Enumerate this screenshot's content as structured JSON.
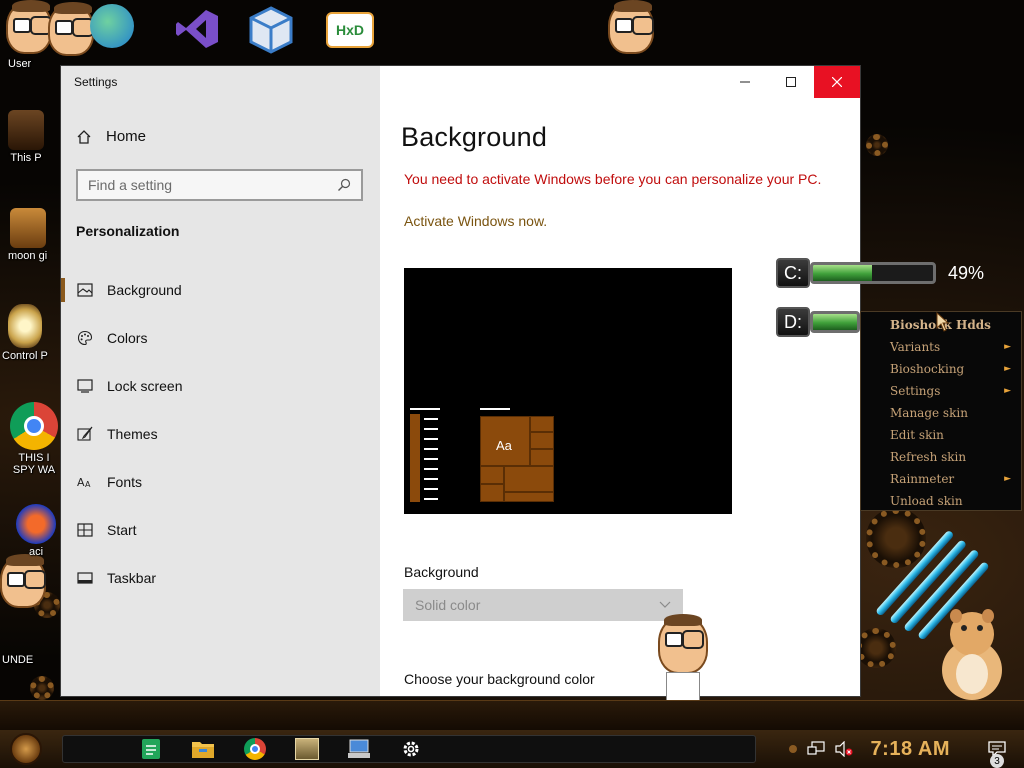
{
  "desktop": {
    "icons": [
      {
        "label": "User",
        "icon": "user-folder-icon"
      },
      {
        "label": "This P",
        "icon": "this-pc-icon"
      },
      {
        "label": "moon gi",
        "icon": "folder-icon"
      },
      {
        "label": "Control P",
        "icon": "control-panel-icon"
      },
      {
        "label": "THIS I",
        "icon": "chrome-icon"
      },
      {
        "label": "SPY WA",
        "icon": "chrome-icon"
      },
      {
        "label": "aci",
        "icon": "audacity-icon"
      },
      {
        "label": "UNDE",
        "icon": "folder-icon"
      }
    ],
    "top_icons": [
      {
        "icon": "edge-icon",
        "color": "#2a8cd8"
      },
      {
        "icon": "visual-studio-icon",
        "color": "#7a4fc9"
      },
      {
        "icon": "virtualbox-icon",
        "color": "#3b7dc8"
      },
      {
        "icon": "hxd-icon",
        "color": "#e8a33a",
        "text": "HxD"
      }
    ]
  },
  "settings": {
    "app_title": "Settings",
    "home_label": "Home",
    "search_placeholder": "Find a setting",
    "section_title": "Personalization",
    "nav": [
      {
        "label": "Background",
        "icon": "picture-icon",
        "active": true
      },
      {
        "label": "Colors",
        "icon": "palette-icon",
        "active": false
      },
      {
        "label": "Lock screen",
        "icon": "lock-screen-icon",
        "active": false
      },
      {
        "label": "Themes",
        "icon": "brush-icon",
        "active": false
      },
      {
        "label": "Fonts",
        "icon": "fonts-icon",
        "active": false
      },
      {
        "label": "Start",
        "icon": "start-icon",
        "active": false
      },
      {
        "label": "Taskbar",
        "icon": "taskbar-icon",
        "active": false
      }
    ],
    "page_title": "Background",
    "warning": "You need to activate Windows before you can personalize your PC.",
    "activate_link": "Activate Windows now.",
    "preview_tile_text": "Aa",
    "background_label": "Background",
    "background_value": "Solid color",
    "choose_label": "Choose your background color",
    "accent": "#8b5a1e",
    "warning_color": "#c00d0d",
    "close_color": "#e81123"
  },
  "gauges": [
    {
      "letter": "C:",
      "fill": 0.49,
      "percent": "49%"
    },
    {
      "letter": "D:",
      "fill": 0.35,
      "percent": ""
    }
  ],
  "context_menu": {
    "items": [
      {
        "label": "Bioshock Hdds",
        "bold": true,
        "submenu": false
      },
      {
        "label": "Variants",
        "bold": false,
        "submenu": true
      },
      {
        "label": "Bioshocking",
        "bold": false,
        "submenu": true
      },
      {
        "label": "Settings",
        "bold": false,
        "submenu": true
      },
      {
        "label": "Manage skin",
        "bold": false,
        "submenu": false
      },
      {
        "label": "Edit skin",
        "bold": false,
        "submenu": false
      },
      {
        "label": "Refresh skin",
        "bold": false,
        "submenu": false
      },
      {
        "label": "Rainmeter",
        "bold": false,
        "submenu": true
      },
      {
        "label": "Unload skin",
        "bold": false,
        "submenu": false
      }
    ]
  },
  "taskbar": {
    "apps": [
      {
        "icon": "sheets-icon",
        "color": "#22a55a"
      },
      {
        "icon": "file-explorer-icon",
        "color": "#f2c24c"
      },
      {
        "icon": "chrome-icon",
        "color": "#e04a3a"
      },
      {
        "icon": "game-icon",
        "color": "#c9b27a"
      },
      {
        "icon": "computer-icon",
        "color": "#4a8ad8"
      },
      {
        "icon": "gear-icon",
        "color": "#ffffff"
      }
    ],
    "clock": "7:18 AM",
    "notification_count": "3"
  }
}
